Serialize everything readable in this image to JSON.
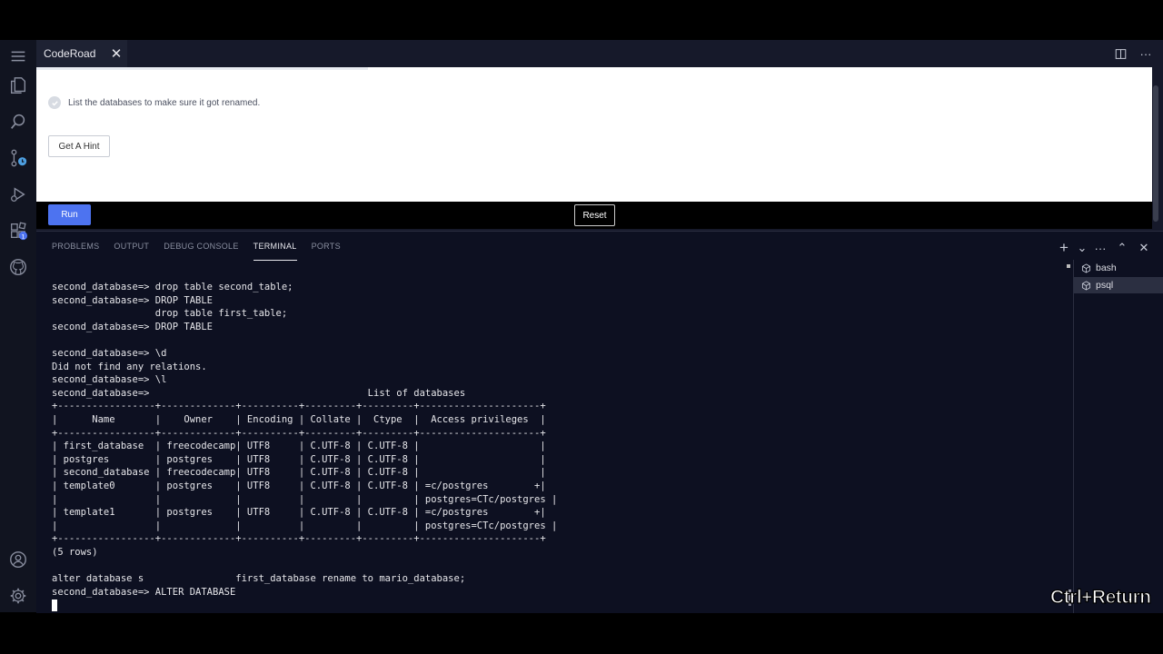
{
  "editor": {
    "tab": {
      "title": "CodeRoad",
      "close": "✕"
    },
    "actions": {
      "split": "split-editor-icon",
      "more": "···"
    }
  },
  "activity_bar": {
    "icons": [
      "menu-icon",
      "explorer-icon",
      "search-icon",
      "source-control-icon",
      "run-debug-icon",
      "extensions-icon",
      "github-icon",
      "account-icon",
      "settings-icon"
    ],
    "extensions_badge": "1"
  },
  "coderoad": {
    "task_text": "List the databases to make sure it got renamed.",
    "hint_button": "Get A Hint",
    "run_button": "Run",
    "reset_button": "Reset"
  },
  "panel": {
    "tabs": [
      "PROBLEMS",
      "OUTPUT",
      "DEBUG CONSOLE",
      "TERMINAL",
      "PORTS"
    ],
    "active_tab": "TERMINAL",
    "actions": {
      "add": "+",
      "dropdown": "⌄",
      "more": "···",
      "maximize": "⌃",
      "close": "✕"
    },
    "terminals": [
      {
        "name": "bash",
        "selected": false
      },
      {
        "name": "psql",
        "selected": true
      }
    ]
  },
  "terminal_lines": [
    "second_database=> drop table second_table;",
    "second_database=> DROP TABLE",
    "                  drop table first_table;",
    "second_database=> DROP TABLE",
    "",
    "second_database=> \\d",
    "Did not find any relations.",
    "second_database=> \\l",
    "second_database=>                                      List of databases",
    "+-----------------+-------------+----------+---------+---------+---------------------+",
    "|      Name       |    Owner    | Encoding | Collate |  Ctype  |  Access privileges  |",
    "+-----------------+-------------+----------+---------+---------+---------------------+",
    "| first_database  | freecodecamp| UTF8     | C.UTF-8 | C.UTF-8 |                     |",
    "| postgres        | postgres    | UTF8     | C.UTF-8 | C.UTF-8 |                     |",
    "| second_database | freecodecamp| UTF8     | C.UTF-8 | C.UTF-8 |                     |",
    "| template0       | postgres    | UTF8     | C.UTF-8 | C.UTF-8 | =c/postgres        +|",
    "|                 |             |          |         |         | postgres=CTc/postgres |",
    "| template1       | postgres    | UTF8     | C.UTF-8 | C.UTF-8 | =c/postgres        +|",
    "|                 |             |          |         |         | postgres=CTc/postgres |",
    "+-----------------+-------------+----------+---------+---------+---------------------+",
    "(5 rows)",
    "",
    "alter database s                first_database rename to mario_database;",
    "second_database=> ALTER DATABASE"
  ],
  "overlay": {
    "key_hint": "Ctrl+Return"
  },
  "colors": {
    "accent": "#4d73f0",
    "terminal_bg": "#0d1021",
    "sidebar_bg": "#111420"
  }
}
